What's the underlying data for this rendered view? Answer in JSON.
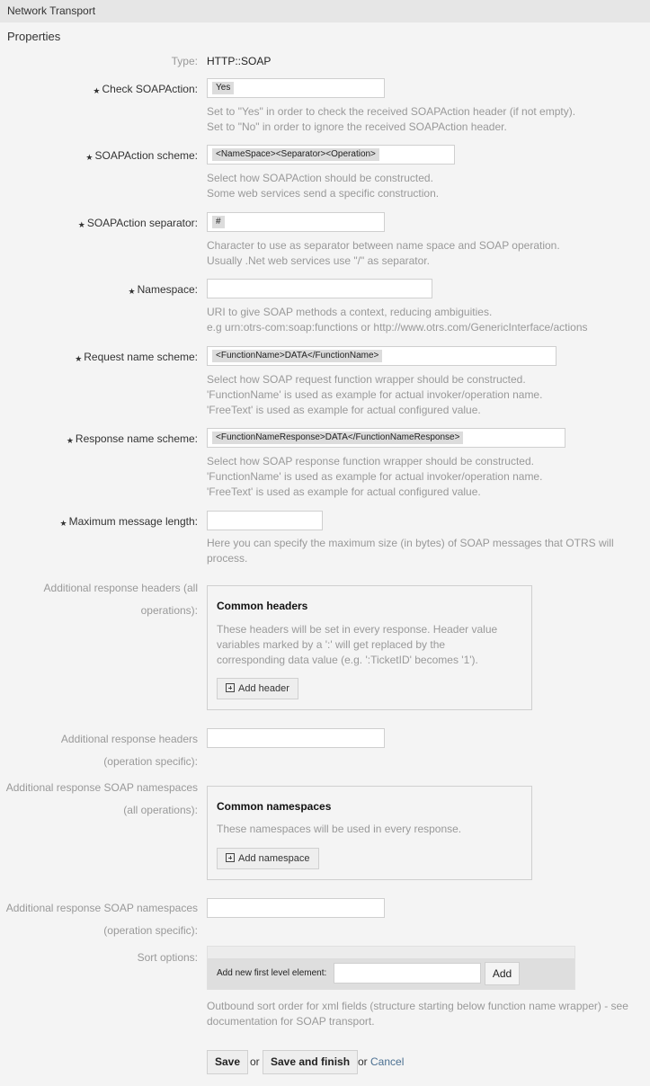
{
  "header": {
    "title": "Network Transport"
  },
  "section": {
    "title": "Properties"
  },
  "fields": {
    "type": {
      "label": "Type:",
      "value": "HTTP::SOAP"
    },
    "check_soapaction": {
      "label": "Check SOAPAction:",
      "value": "Yes",
      "required": true,
      "hint": [
        "Set to \"Yes\" in order to check the received SOAPAction header (if not empty).",
        "Set to \"No\" in order to ignore the received SOAPAction header."
      ]
    },
    "soapaction_scheme": {
      "label": "SOAPAction scheme:",
      "value": "<NameSpace><Separator><Operation>",
      "required": true,
      "hint": [
        "Select how SOAPAction should be constructed.",
        "Some web services send a specific construction."
      ]
    },
    "soapaction_separator": {
      "label": "SOAPAction separator:",
      "value": "#",
      "required": true,
      "hint": [
        "Character to use as separator between name space and SOAP operation.",
        "Usually .Net web services use \"/\" as separator."
      ]
    },
    "namespace": {
      "label": "Namespace:",
      "value": "",
      "required": true,
      "hint": [
        "URI to give SOAP methods a context, reducing ambiguities.",
        "e.g urn:otrs-com:soap:functions or http://www.otrs.com/GenericInterface/actions"
      ]
    },
    "request_name_scheme": {
      "label": "Request name scheme:",
      "value": "<FunctionName>DATA</FunctionName>",
      "required": true,
      "hint": [
        "Select how SOAP request function wrapper should be constructed.",
        "'FunctionName' is used as example for actual invoker/operation name.",
        "'FreeText' is used as example for actual configured value."
      ]
    },
    "response_name_scheme": {
      "label": "Response name scheme:",
      "value": "<FunctionNameResponse>DATA</FunctionNameResponse>",
      "required": true,
      "hint": [
        "Select how SOAP response function wrapper should be constructed.",
        "'FunctionName' is used as example for actual invoker/operation name.",
        "'FreeText' is used as example for actual configured value."
      ]
    },
    "max_message_length": {
      "label": "Maximum message length:",
      "value": "",
      "required": true,
      "hint": [
        "Here you can specify the maximum size (in bytes) of SOAP messages that OTRS will",
        "process."
      ]
    },
    "resp_headers_all": {
      "label": [
        "Additional response headers (all",
        "operations):"
      ],
      "box_title": "Common headers",
      "box_text": [
        "These headers will be set in every response. Header value",
        "variables marked by a ':' will get replaced by the",
        "corresponding data value (e.g. ':TicketID' becomes '1')."
      ],
      "button": "Add header"
    },
    "resp_headers_specific": {
      "label": [
        "Additional response headers",
        "(operation specific):"
      ],
      "value": ""
    },
    "resp_ns_all": {
      "label": [
        "Additional response SOAP namespaces",
        "(all operations):"
      ],
      "box_title": "Common namespaces",
      "box_text": [
        "These namespaces will be used in every response."
      ],
      "button": "Add namespace"
    },
    "resp_ns_specific": {
      "label": [
        "Additional response SOAP namespaces",
        "(operation specific):"
      ],
      "value": ""
    },
    "sort_options": {
      "label": "Sort options:",
      "add_label": "Add new first level element:",
      "add_value": "",
      "add_button": "Add",
      "hint": [
        "Outbound sort order for xml fields (structure starting below function name wrapper) - see",
        "documentation for SOAP transport."
      ]
    }
  },
  "actions": {
    "save": "Save",
    "or1": "or",
    "save_finish": "Save and finish",
    "or2": "or",
    "cancel": "Cancel"
  },
  "colors": {
    "link": "#4b7091",
    "background": "#f4f4f4",
    "header": "#e6e6e6"
  }
}
